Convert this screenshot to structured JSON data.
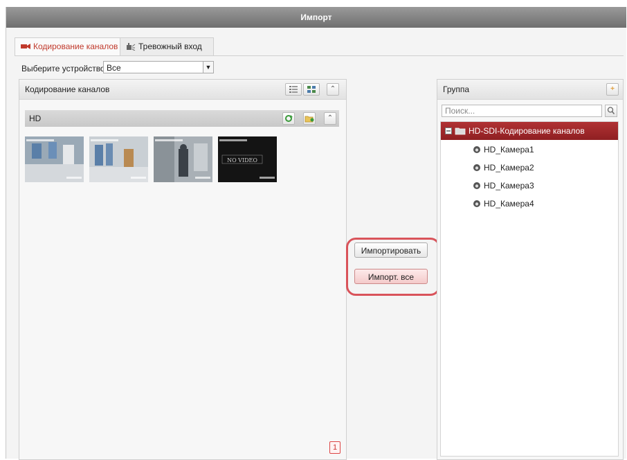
{
  "window": {
    "title": "Импорт"
  },
  "tabs": [
    {
      "label": "Кодирование каналов",
      "active": true,
      "icon": "camera-icon"
    },
    {
      "label": "Тревожный вход",
      "active": false,
      "icon": "alarm-input-icon"
    }
  ],
  "device_select": {
    "label": "Выберите устройство",
    "value": "Все"
  },
  "channels_panel": {
    "title": "Кодирование каналов",
    "group": {
      "name": "HD"
    },
    "thumbnails": [
      {
        "caption": ""
      },
      {
        "caption": ""
      },
      {
        "caption": ""
      },
      {
        "caption": "NO VIDEO"
      }
    ],
    "page": "1"
  },
  "actions": {
    "import_label": "Импортировать",
    "import_all_label": "Импорт. все"
  },
  "group_panel": {
    "title": "Группа",
    "search_placeholder": "Поиск...",
    "tree": {
      "root_label": "HD-SDI-Кодирование каналов",
      "items": [
        {
          "label": "HD_Камера1"
        },
        {
          "label": "HD_Камера2"
        },
        {
          "label": "HD_Камера3"
        },
        {
          "label": "HD_Камера4"
        }
      ]
    }
  },
  "colors": {
    "accent_red": "#c0392b",
    "tree_root_bg": "#a0282b",
    "highlight_ring": "#d9535a"
  }
}
